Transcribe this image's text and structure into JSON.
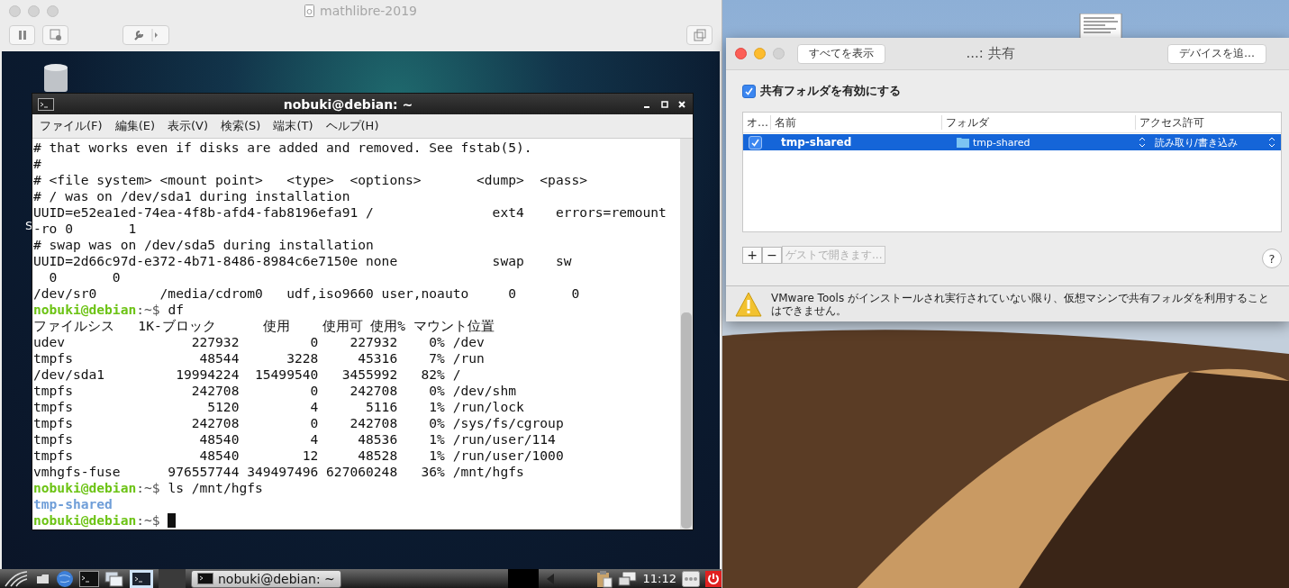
{
  "vm_window": {
    "title": "mathlibre-2019"
  },
  "guest_desktop": {
    "icon_label": "S"
  },
  "terminal": {
    "title": "nobuki@debian: ~",
    "menu": [
      "ファイル(F)",
      "編集(E)",
      "表示(V)",
      "検索(S)",
      "端末(T)",
      "ヘルプ(H)"
    ],
    "lines": [
      {
        "kind": "text",
        "text": "# that works even if disks are added and removed. See fstab(5)."
      },
      {
        "kind": "text",
        "text": "#"
      },
      {
        "kind": "text",
        "text": "# <file system> <mount point>   <type>  <options>       <dump>  <pass>"
      },
      {
        "kind": "text",
        "text": "# / was on /dev/sda1 during installation"
      },
      {
        "kind": "text",
        "text": "UUID=e52ea1ed-74ea-4f8b-afd4-fab8196efa91 /               ext4    errors=remount"
      },
      {
        "kind": "text",
        "text": "-ro 0       1"
      },
      {
        "kind": "text",
        "text": "# swap was on /dev/sda5 during installation"
      },
      {
        "kind": "text",
        "text": "UUID=2d66c97d-e372-4b71-8486-8984c6e7150e none            swap    sw"
      },
      {
        "kind": "text",
        "text": "  0       0"
      },
      {
        "kind": "text",
        "text": "/dev/sr0        /media/cdrom0   udf,iso9660 user,noauto     0       0"
      },
      {
        "kind": "prompt",
        "user": "nobuki@debian",
        "sep": ":~$ ",
        "command": "df",
        "cursor": false
      },
      {
        "kind": "text",
        "text": "ファイルシス   1K-ブロック      使用    使用可 使用% マウント位置"
      },
      {
        "kind": "text",
        "text": "udev                227932         0    227932    0% /dev"
      },
      {
        "kind": "text",
        "text": "tmpfs                48544      3228     45316    7% /run"
      },
      {
        "kind": "text",
        "text": "/dev/sda1         19994224  15499540   3455992   82% /"
      },
      {
        "kind": "text",
        "text": "tmpfs               242708         0    242708    0% /dev/shm"
      },
      {
        "kind": "text",
        "text": "tmpfs                 5120         4      5116    1% /run/lock"
      },
      {
        "kind": "text",
        "text": "tmpfs               242708         0    242708    0% /sys/fs/cgroup"
      },
      {
        "kind": "text",
        "text": "tmpfs                48540         4     48536    1% /run/user/114"
      },
      {
        "kind": "text",
        "text": "tmpfs                48540        12     48528    1% /run/user/1000"
      },
      {
        "kind": "text",
        "text": "vmhgfs-fuse      976557744 349497496 627060248   36% /mnt/hgfs"
      },
      {
        "kind": "prompt",
        "user": "nobuki@debian",
        "sep": ":~$ ",
        "command": "ls /mnt/hgfs",
        "cursor": false
      },
      {
        "kind": "dir",
        "text": "tmp-shared"
      },
      {
        "kind": "prompt",
        "user": "nobuki@debian",
        "sep": ":~$ ",
        "cursor": true
      }
    ]
  },
  "taskbar": {
    "task": {
      "label": "nobuki@debian: ~",
      "selected": true
    },
    "clock": "11:12"
  },
  "prefs": {
    "show_all": "すべてを表示",
    "title": "...: 共有",
    "add_device": "デバイスを追…",
    "enable_sharing": {
      "label": "共有フォルダを有効にする",
      "checked": true
    },
    "columns": [
      "オ…",
      "名前",
      "フォルダ",
      "アクセス許可"
    ],
    "rows": [
      {
        "on": true,
        "name": "tmp-shared",
        "folder": "tmp-shared",
        "access": "読み取り/書き込み",
        "selected": true
      }
    ],
    "add": "+",
    "remove": "−",
    "open_in_guest": {
      "label": "ゲストで開きます...",
      "disabled": true
    },
    "help": "?",
    "warning": "VMware Tools がインストールされ実行されていない限り、仮想マシンで共有フォルダを利用することはできません。"
  }
}
